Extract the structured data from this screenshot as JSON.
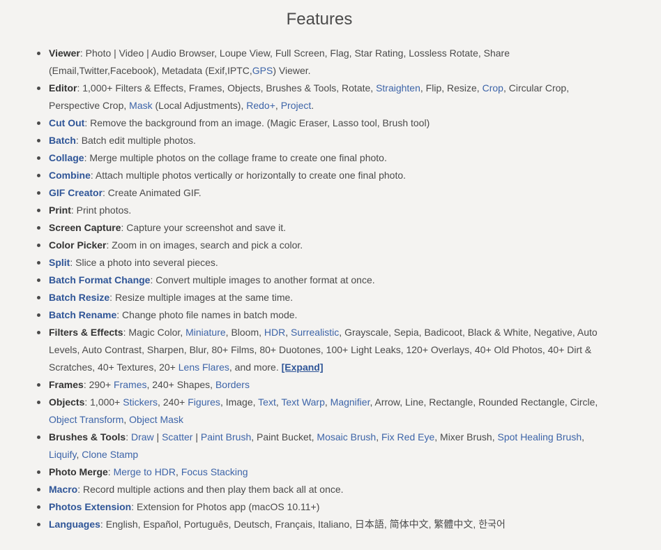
{
  "title": "Features",
  "features": [
    {
      "name": "Viewer",
      "name_link": false,
      "parts": [
        {
          "t": "Photo | Video | Audio Browser, Loupe View, Full Screen, Flag, Star Rating, Lossless Rotate, Share (Email,Twitter,Facebook), Metadata (Exif,IPTC,"
        },
        {
          "t": "GPS",
          "link": true
        },
        {
          "t": ") Viewer."
        }
      ]
    },
    {
      "name": "Editor",
      "name_link": false,
      "parts": [
        {
          "t": "1,000+ Filters & Effects, Frames, Objects, Brushes & Tools, Rotate, "
        },
        {
          "t": "Straighten",
          "link": true
        },
        {
          "t": ", Flip, Resize, "
        },
        {
          "t": "Crop",
          "link": true
        },
        {
          "t": ", Circular Crop, Perspective Crop, "
        },
        {
          "t": "Mask",
          "link": true
        },
        {
          "t": " (Local Adjustments), "
        },
        {
          "t": "Redo+",
          "link": true
        },
        {
          "t": ", "
        },
        {
          "t": "Project",
          "link": true
        },
        {
          "t": "."
        }
      ]
    },
    {
      "name": "Cut Out",
      "name_link": true,
      "parts": [
        {
          "t": "Remove the background from an image. (Magic Eraser, Lasso tool, Brush tool)"
        }
      ]
    },
    {
      "name": "Batch",
      "name_link": true,
      "parts": [
        {
          "t": "Batch edit multiple photos."
        }
      ]
    },
    {
      "name": "Collage",
      "name_link": true,
      "parts": [
        {
          "t": "Merge multiple photos on the collage frame to create one final photo."
        }
      ]
    },
    {
      "name": "Combine",
      "name_link": true,
      "parts": [
        {
          "t": "Attach multiple photos vertically or horizontally to create one final photo."
        }
      ]
    },
    {
      "name": "GIF Creator",
      "name_link": true,
      "parts": [
        {
          "t": "Create Animated GIF."
        }
      ]
    },
    {
      "name": "Print",
      "name_link": false,
      "parts": [
        {
          "t": "Print photos."
        }
      ]
    },
    {
      "name": "Screen Capture",
      "name_link": false,
      "parts": [
        {
          "t": "Capture your screenshot and save it."
        }
      ]
    },
    {
      "name": "Color Picker",
      "name_link": false,
      "parts": [
        {
          "t": "Zoom in on images, search and pick a color."
        }
      ]
    },
    {
      "name": "Split",
      "name_link": true,
      "parts": [
        {
          "t": "Slice a photo into several pieces."
        }
      ]
    },
    {
      "name": "Batch Format Change",
      "name_link": true,
      "parts": [
        {
          "t": "Convert multiple images to another format at once."
        }
      ]
    },
    {
      "name": "Batch Resize",
      "name_link": true,
      "parts": [
        {
          "t": "Resize multiple images at the same time."
        }
      ]
    },
    {
      "name": "Batch Rename",
      "name_link": true,
      "parts": [
        {
          "t": "Change photo file names in batch mode."
        }
      ]
    },
    {
      "name": "Filters & Effects",
      "name_link": false,
      "parts": [
        {
          "t": "Magic Color, "
        },
        {
          "t": "Miniature",
          "link": true
        },
        {
          "t": ", Bloom, "
        },
        {
          "t": "HDR",
          "link": true
        },
        {
          "t": ", "
        },
        {
          "t": "Surrealistic",
          "link": true
        },
        {
          "t": ", Grayscale, Sepia, Badicoot, Black & White, Negative, Auto Levels, Auto Contrast, Sharpen, Blur, 80+ Films, 80+ Duotones, 100+ Light Leaks, 120+ Overlays, 40+ Old Photos, 40+ Dirt & Scratches, 40+ Textures, 20+ "
        },
        {
          "t": "Lens Flares",
          "link": true
        },
        {
          "t": ", and more. "
        },
        {
          "t": "[Expand]",
          "link": true,
          "expand": true
        }
      ]
    },
    {
      "name": "Frames",
      "name_link": false,
      "parts": [
        {
          "t": "290+ "
        },
        {
          "t": "Frames",
          "link": true
        },
        {
          "t": ", 240+ Shapes, "
        },
        {
          "t": "Borders",
          "link": true
        }
      ]
    },
    {
      "name": "Objects",
      "name_link": false,
      "parts": [
        {
          "t": "1,000+ "
        },
        {
          "t": "Stickers",
          "link": true
        },
        {
          "t": ", 240+ "
        },
        {
          "t": "Figures",
          "link": true
        },
        {
          "t": ", Image, "
        },
        {
          "t": "Text",
          "link": true
        },
        {
          "t": ", "
        },
        {
          "t": "Text Warp",
          "link": true
        },
        {
          "t": ", "
        },
        {
          "t": "Magnifier",
          "link": true
        },
        {
          "t": ", Arrow, Line, Rectangle, Rounded Rectangle, Circle, "
        },
        {
          "t": "Object Transform",
          "link": true
        },
        {
          "t": ", "
        },
        {
          "t": "Object Mask",
          "link": true
        }
      ]
    },
    {
      "name": "Brushes & Tools",
      "name_link": false,
      "parts": [
        {
          "t": "Draw",
          "link": true
        },
        {
          "t": " | "
        },
        {
          "t": "Scatter",
          "link": true
        },
        {
          "t": " | "
        },
        {
          "t": "Paint Brush",
          "link": true
        },
        {
          "t": ", Paint Bucket, "
        },
        {
          "t": "Mosaic Brush",
          "link": true
        },
        {
          "t": ", "
        },
        {
          "t": "Fix Red Eye",
          "link": true
        },
        {
          "t": ", Mixer Brush, "
        },
        {
          "t": "Spot Healing Brush",
          "link": true
        },
        {
          "t": ", "
        },
        {
          "t": "Liquify",
          "link": true
        },
        {
          "t": ", "
        },
        {
          "t": "Clone Stamp",
          "link": true
        }
      ]
    },
    {
      "name": "Photo Merge",
      "name_link": false,
      "parts": [
        {
          "t": "Merge to HDR",
          "link": true
        },
        {
          "t": ", "
        },
        {
          "t": "Focus Stacking",
          "link": true
        }
      ]
    },
    {
      "name": "Macro",
      "name_link": true,
      "parts": [
        {
          "t": "Record multiple actions and then play them back all at once."
        }
      ]
    },
    {
      "name": "Photos Extension",
      "name_link": true,
      "parts": [
        {
          "t": "Extension for Photos app (macOS 10.11+)"
        }
      ]
    },
    {
      "name": "Languages",
      "name_link": true,
      "parts": [
        {
          "t": "English, Español, Português, Deutsch, Français, Italiano, 日本語, 简体中文, 繁體中文, 한국어"
        }
      ]
    }
  ]
}
